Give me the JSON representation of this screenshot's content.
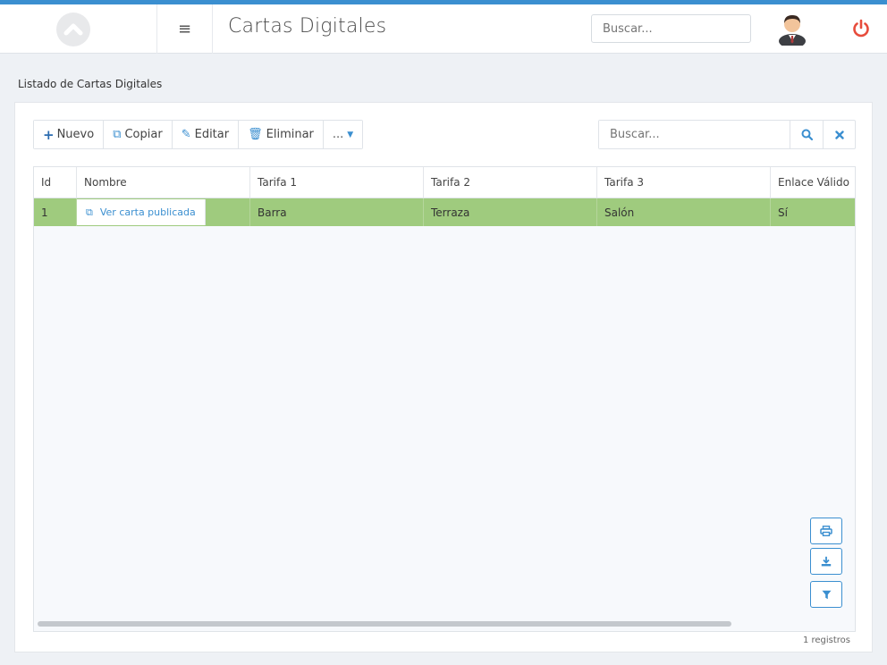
{
  "header": {
    "app_title": "Cartas Digitales",
    "search_placeholder": "Buscar...",
    "menu_icon": "hamburger-icon",
    "power_icon_color": "#e74c3c",
    "accent_color": "#3b8fd0"
  },
  "page": {
    "section_label": "Listado de Cartas Digitales"
  },
  "toolbar": {
    "new_label": "Nuevo",
    "copy_label": "Copiar",
    "edit_label": "Editar",
    "delete_label": "Eliminar",
    "more_label": "..."
  },
  "grid_search": {
    "placeholder": "Buscar..."
  },
  "table": {
    "columns": [
      "Id",
      "Nombre",
      "Tarifa 1",
      "Tarifa 2",
      "Tarifa 3",
      "Enlace Válido"
    ],
    "rows": [
      {
        "id": "1",
        "nombre_link": "Ver carta publicada",
        "tarifa1": "Barra",
        "tarifa2": "Terraza",
        "tarifa3": "Salón",
        "enlace_valido": "Sí"
      }
    ],
    "selected_row_color": "#9fcb7e"
  },
  "footer": {
    "records_text": "1 registros"
  }
}
